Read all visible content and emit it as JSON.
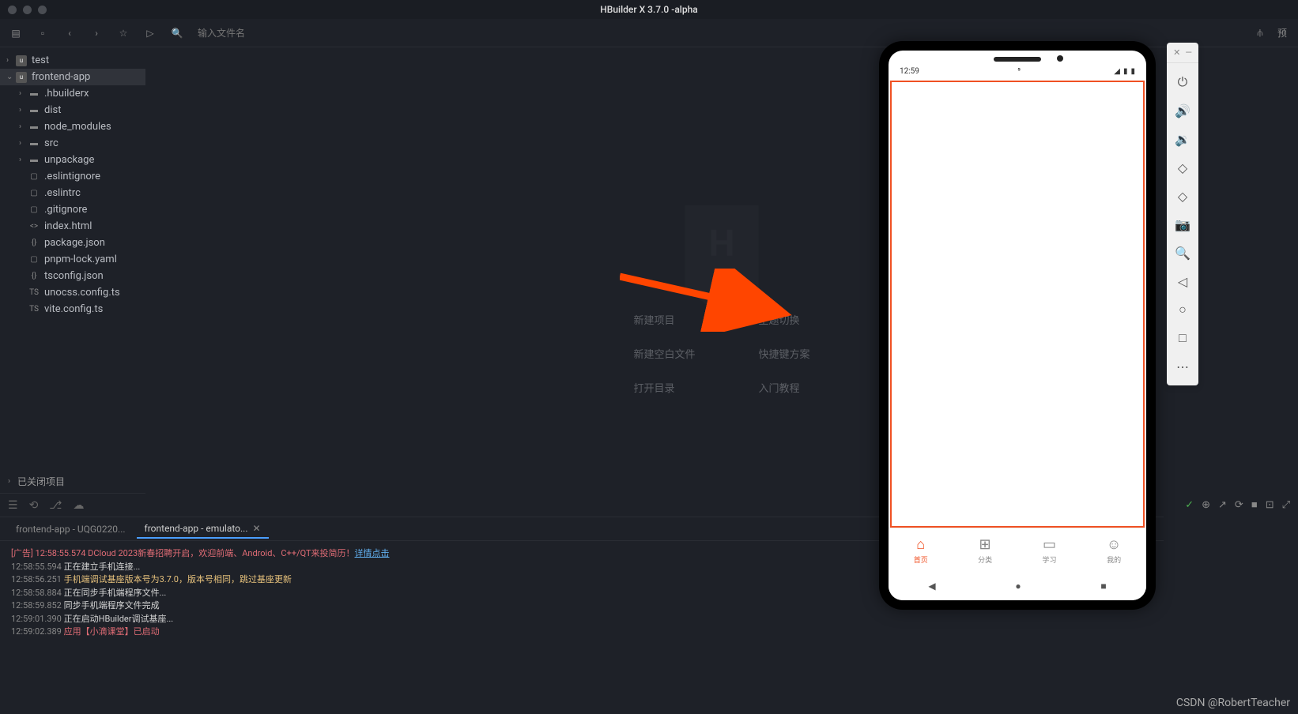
{
  "window": {
    "title": "HBuilder X 3.7.0 -alpha"
  },
  "toolbar": {
    "search_placeholder": "输入文件名",
    "preview_label": "预"
  },
  "tree": {
    "items": [
      {
        "label": "test",
        "indent": 0,
        "icon": "app",
        "chev": "›"
      },
      {
        "label": "frontend-app",
        "indent": 0,
        "icon": "app",
        "chev": "⌄",
        "selected": true
      },
      {
        "label": ".hbuilderx",
        "indent": 1,
        "icon": "folder",
        "chev": "›"
      },
      {
        "label": "dist",
        "indent": 1,
        "icon": "folder",
        "chev": "›"
      },
      {
        "label": "node_modules",
        "indent": 1,
        "icon": "folder",
        "chev": "›"
      },
      {
        "label": "src",
        "indent": 1,
        "icon": "folder",
        "chev": "›"
      },
      {
        "label": "unpackage",
        "indent": 1,
        "icon": "folder",
        "chev": "›"
      },
      {
        "label": ".eslintignore",
        "indent": 1,
        "icon": "file",
        "glyph": "▢"
      },
      {
        "label": ".eslintrc",
        "indent": 1,
        "icon": "file",
        "glyph": "▢"
      },
      {
        "label": ".gitignore",
        "indent": 1,
        "icon": "file",
        "glyph": "▢"
      },
      {
        "label": "index.html",
        "indent": 1,
        "icon": "file",
        "glyph": "<>"
      },
      {
        "label": "package.json",
        "indent": 1,
        "icon": "file",
        "glyph": "{}"
      },
      {
        "label": "pnpm-lock.yaml",
        "indent": 1,
        "icon": "file",
        "glyph": "▢"
      },
      {
        "label": "tsconfig.json",
        "indent": 1,
        "icon": "file",
        "glyph": "{}"
      },
      {
        "label": "unocss.config.ts",
        "indent": 1,
        "icon": "file",
        "glyph": "TS"
      },
      {
        "label": "vite.config.ts",
        "indent": 1,
        "icon": "file",
        "glyph": "TS"
      }
    ],
    "closed_section": "已关闭项目"
  },
  "welcome": {
    "col1": [
      "新建项目",
      "新建空白文件",
      "打开目录"
    ],
    "col2": [
      "主题切换",
      "快捷键方案",
      "入门教程"
    ]
  },
  "console": {
    "tabs": [
      {
        "label": "frontend-app - UQG0220..."
      },
      {
        "label": "frontend-app - emulato...",
        "active": true,
        "closable": true
      }
    ],
    "lines": [
      {
        "parts": [
          {
            "t": "[广告] 12:58:55.574 DCloud 2023新春招聘开启，欢迎前端、Android、C++/QT来投简历！",
            "c": "c-red"
          },
          {
            "t": "详情点击",
            "c": "c-link"
          }
        ]
      },
      {
        "parts": [
          {
            "t": "12:58:55.594 ",
            "c": "c-time"
          },
          {
            "t": "正在建立手机连接...",
            "c": "c-white"
          }
        ]
      },
      {
        "parts": [
          {
            "t": "12:58:56.251 ",
            "c": "c-time"
          },
          {
            "t": "手机端调试基座版本号为3.7.0，版本号相同，跳过基座更新",
            "c": "c-yellow"
          }
        ]
      },
      {
        "parts": [
          {
            "t": "12:58:58.884 ",
            "c": "c-time"
          },
          {
            "t": "正在同步手机端程序文件...",
            "c": "c-white"
          }
        ]
      },
      {
        "parts": [
          {
            "t": "12:58:59.852 ",
            "c": "c-time"
          },
          {
            "t": "同步手机端程序文件完成",
            "c": "c-white"
          }
        ]
      },
      {
        "parts": [
          {
            "t": "12:59:01.390 ",
            "c": "c-time"
          },
          {
            "t": "正在启动HBuilder调试基座...",
            "c": "c-white"
          }
        ]
      },
      {
        "parts": [
          {
            "t": "12:59:02.389 ",
            "c": "c-time"
          },
          {
            "t": "应用【小滴课堂】已启动",
            "c": "c-red"
          }
        ]
      }
    ]
  },
  "phone": {
    "time": "12:59",
    "tabs": [
      {
        "icon": "⌂",
        "label": "首页",
        "active": true
      },
      {
        "icon": "⊞",
        "label": "分类"
      },
      {
        "icon": "▭",
        "label": "学习"
      },
      {
        "icon": "☺",
        "label": "我的"
      }
    ]
  },
  "watermark": "CSDN @RobertTeacher"
}
